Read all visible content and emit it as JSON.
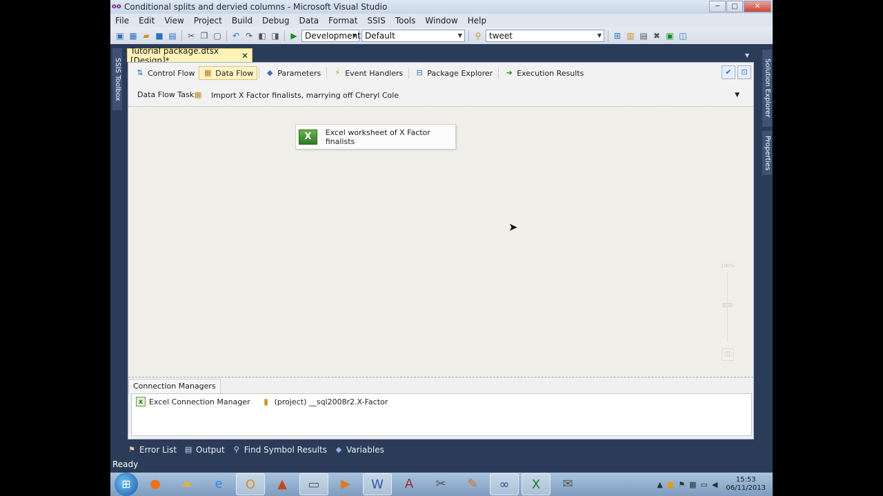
{
  "window": {
    "title": "Conditional splits and dervied columns - Microsoft Visual Studio",
    "logo": "oo",
    "minimize": "─",
    "maximize": "□",
    "close": "✕"
  },
  "menu": [
    "File",
    "Edit",
    "View",
    "Project",
    "Build",
    "Debug",
    "Data",
    "Format",
    "SSIS",
    "Tools",
    "Window",
    "Help"
  ],
  "toolbar": {
    "config_combo": "Development",
    "platform_combo": "Default",
    "find_combo": "tweet"
  },
  "left_strip": {
    "ssis_toolbox": "SSIS Toolbox"
  },
  "right_strip": {
    "solution_explorer": "Solution Explorer",
    "properties": "Properties"
  },
  "document_tab": {
    "label": "Tutorial package.dtsx [Design]*",
    "close": "✕"
  },
  "designer_tabs": [
    {
      "label": "Control Flow",
      "icon": "control-flow-icon",
      "active": false
    },
    {
      "label": "Data Flow",
      "icon": "data-flow-icon",
      "active": true
    },
    {
      "label": "Parameters",
      "icon": "parameters-icon",
      "active": false
    },
    {
      "label": "Event Handlers",
      "icon": "event-handlers-icon",
      "active": false
    },
    {
      "label": "Package Explorer",
      "icon": "package-explorer-icon",
      "active": false
    },
    {
      "label": "Execution Results",
      "icon": "execution-results-icon",
      "active": false
    }
  ],
  "task_row": {
    "label": "Data Flow Task:",
    "value": "Import X Factor finalists, marrying off Cheryl Cole"
  },
  "canvas": {
    "component_name": "Excel worksheet of X Factor finalists",
    "zoom_label": "100%"
  },
  "connection_managers": {
    "tab_label": "Connection Managers",
    "items": [
      {
        "label": "Excel Connection Manager",
        "icon": "excel-connection-icon"
      },
      {
        "label": "(project) __sql2008r2.X-Factor",
        "icon": "database-connection-icon"
      }
    ]
  },
  "bottom_tabs": [
    "Error List",
    "Output",
    "Find Symbol Results",
    "Variables"
  ],
  "status": "Ready",
  "taskbar": {
    "apps": [
      "firefox-icon",
      "explorer-icon",
      "ie-icon",
      "outlook-icon",
      "powerpoint-icon",
      "window-icon",
      "media-player-icon",
      "word-icon",
      "access-icon",
      "tool-icon",
      "app-icon",
      "visual-studio-icon",
      "excel-icon",
      "email-icon"
    ],
    "clock_time": "15:53",
    "clock_date": "06/11/2013"
  }
}
